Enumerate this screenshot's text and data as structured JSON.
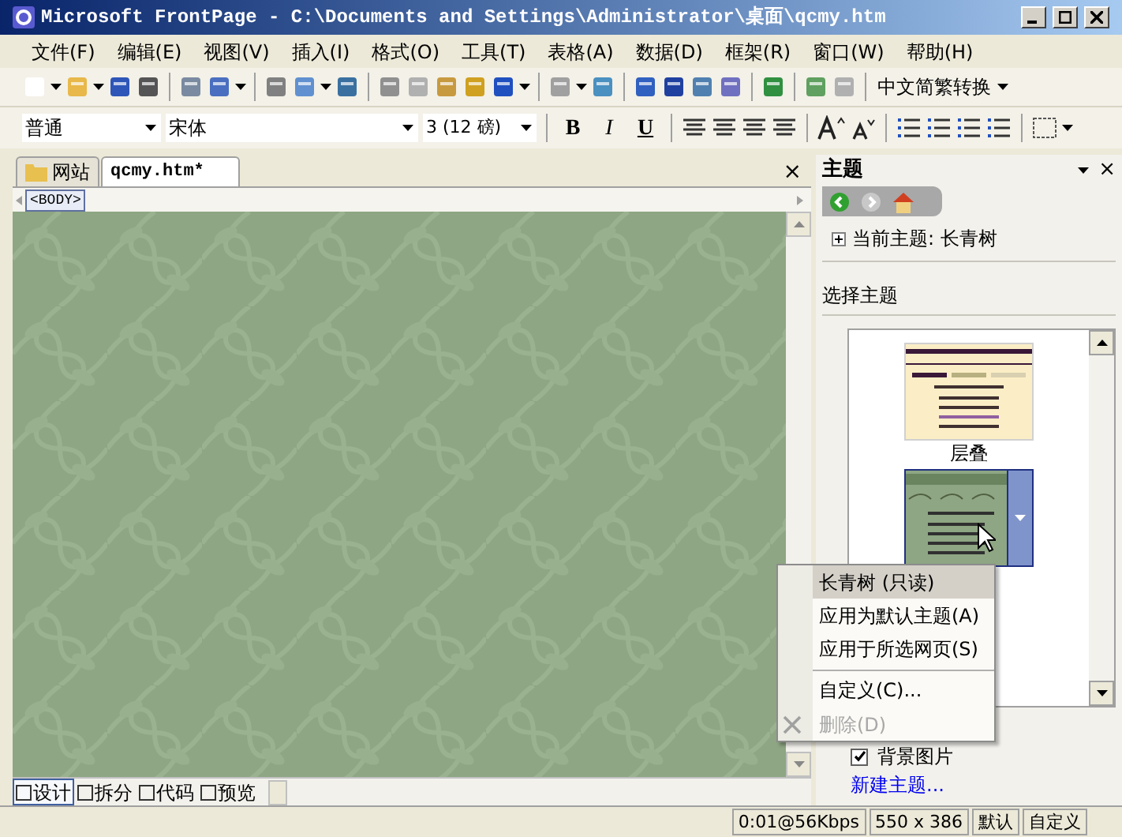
{
  "window": {
    "title": "Microsoft FrontPage - C:\\Documents and Settings\\Administrator\\桌面\\qcmy.htm"
  },
  "menu": [
    "文件(F)",
    "编辑(E)",
    "视图(V)",
    "插入(I)",
    "格式(O)",
    "工具(T)",
    "表格(A)",
    "数据(D)",
    "框架(R)",
    "窗口(W)",
    "帮助(H)"
  ],
  "toolbar": {
    "convert_dropdown": "中文简繁转换"
  },
  "format_bar": {
    "style": "普通",
    "font": "宋体",
    "size": "3 (12 磅)",
    "bold": "B",
    "italic": "I",
    "underline": "U"
  },
  "doc_tabs": [
    {
      "label": "网站",
      "kind": "site",
      "selected": false
    },
    {
      "label": "qcmy.htm*",
      "kind": "file",
      "selected": true
    }
  ],
  "doc_close": "×",
  "tag": "<BODY>",
  "view_tabs": [
    {
      "label": "设计",
      "selected": true
    },
    {
      "label": "拆分",
      "selected": false
    },
    {
      "label": "代码",
      "selected": false
    },
    {
      "label": "预览",
      "selected": false
    }
  ],
  "panel": {
    "title": "主题",
    "close": "×",
    "current_theme": {
      "label": "当前主题: 长青树",
      "expanded": false
    },
    "section": "选择主题",
    "themes": [
      {
        "label": "层叠",
        "kind": "cream",
        "selected": false
      },
      {
        "kind": "green",
        "selected": true
      }
    ],
    "options": [
      {
        "label": "背景图片",
        "checked": true
      }
    ],
    "new_link": "新建主题..."
  },
  "context_menu": [
    {
      "label": "长青树 (只读)",
      "selected": true,
      "disabled": false,
      "separator_before": false
    },
    {
      "label": "应用为默认主题(A)",
      "selected": false,
      "disabled": false,
      "separator_before": false
    },
    {
      "label": "应用于所选网页(S)",
      "selected": false,
      "disabled": false,
      "separator_before": false
    },
    {
      "label": "自定义(C)...",
      "selected": false,
      "disabled": false,
      "separator_before": true
    },
    {
      "label": "删除(D)",
      "selected": false,
      "disabled": true,
      "separator_before": false
    }
  ],
  "status_bar": [
    "0:01@56Kbps",
    "550 x 386",
    "默认",
    "自定义"
  ]
}
